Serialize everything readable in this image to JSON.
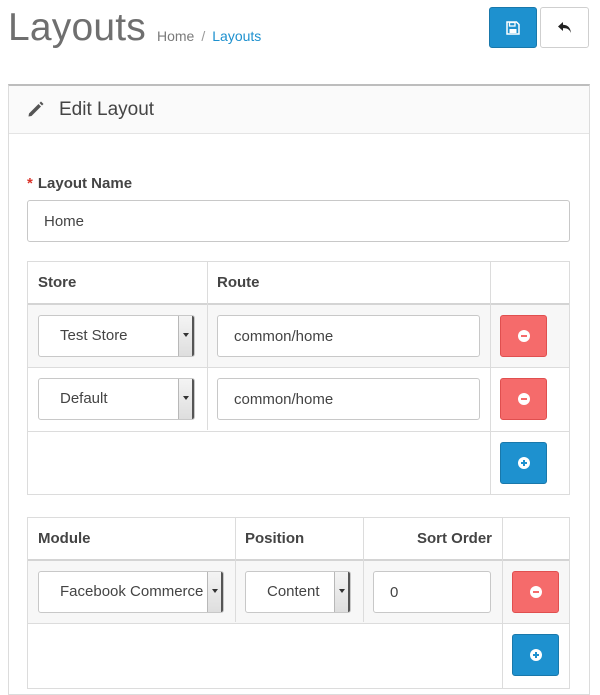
{
  "header": {
    "title": "Layouts",
    "breadcrumb": [
      {
        "label": "Home"
      },
      {
        "label": "Layouts"
      }
    ],
    "save_icon": "save-icon",
    "back_icon": "reply-icon"
  },
  "panel": {
    "title": "Edit Layout",
    "icon": "pencil-icon"
  },
  "layout_name": {
    "label": "Layout Name",
    "required_mark": "*",
    "value": "Home"
  },
  "routes_table": {
    "headers": {
      "store": "Store",
      "route": "Route"
    },
    "rows": [
      {
        "store": "Test Store",
        "route": "common/home"
      },
      {
        "store": "Default",
        "route": "common/home"
      }
    ]
  },
  "modules_table": {
    "headers": {
      "module": "Module",
      "position": "Position",
      "sort_order": "Sort Order"
    },
    "rows": [
      {
        "module": "Facebook Commerce",
        "position": "Content",
        "sort_order": "0"
      }
    ]
  },
  "colors": {
    "primary": "#1e91cf",
    "danger": "#f56b6b",
    "required": "#d9332a"
  }
}
